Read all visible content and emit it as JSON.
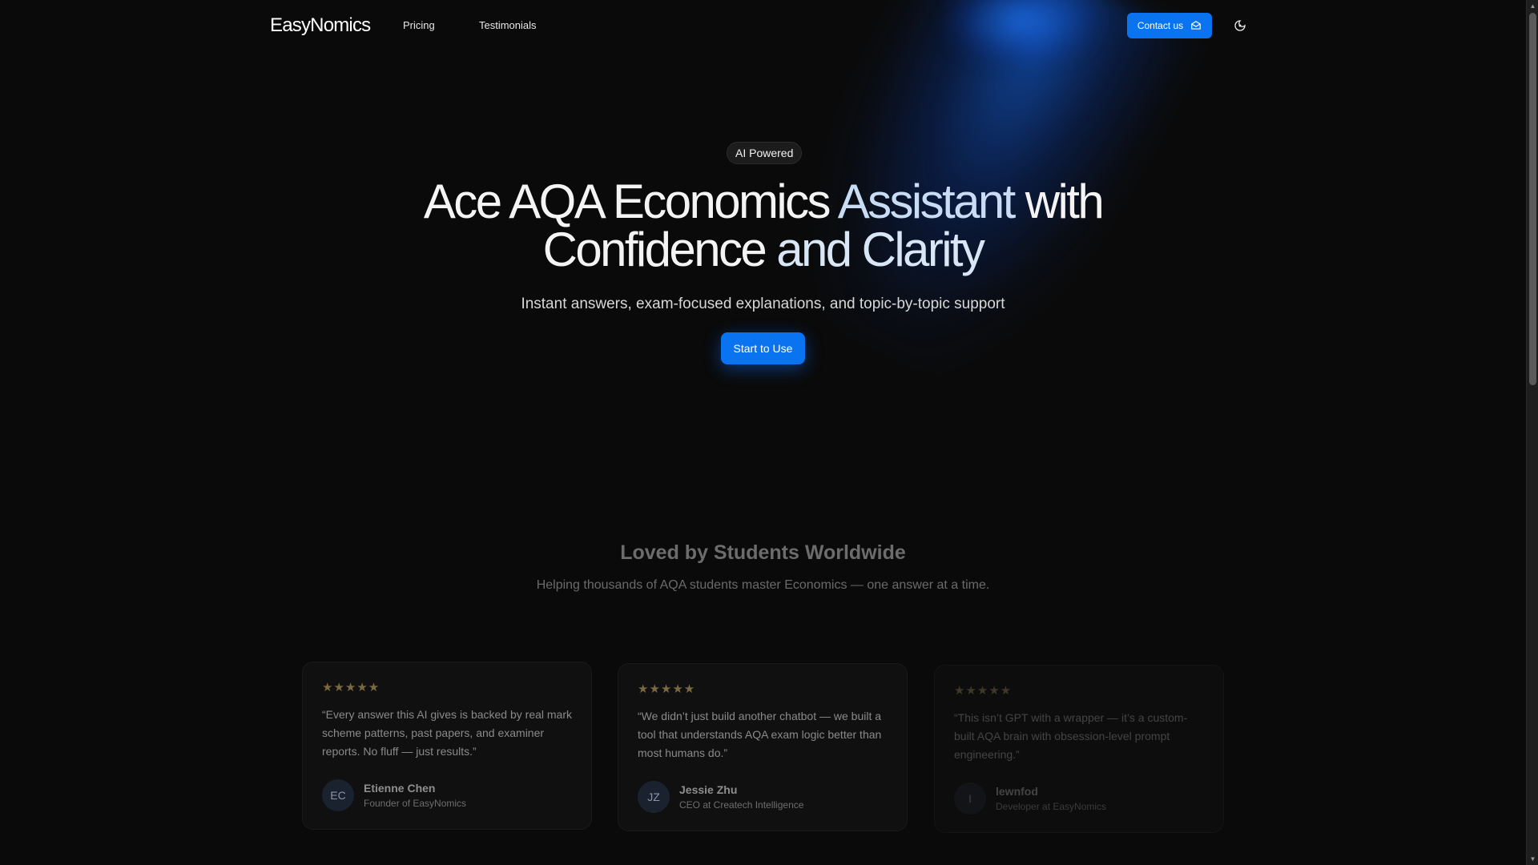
{
  "brand": {
    "logo": "EasyNomics",
    "accent_color": "#0a74f0"
  },
  "nav": {
    "links": [
      "Pricing",
      "Testimonials"
    ],
    "contact_label": "Contact us",
    "contact_icon": "mail-icon",
    "theme_icon": "theme-toggle-icon"
  },
  "hero": {
    "badge": "AI Powered",
    "title_part1": "Ace AQA Economics ",
    "title_highlight1": "Assistant",
    "title_part2": " with",
    "title_part3": "Confidence ",
    "title_highlight2": "and Clarity",
    "subtitle": "Instant answers, exam-focused explanations, and topic-by-topic support",
    "cta_label": "Start to Use"
  },
  "testimonials": {
    "title": "Loved by Students Worldwide",
    "subtitle": "Helping thousands of AQA students master Economics — one answer at a time.",
    "star_color": "#7a6a40",
    "items": [
      {
        "stars": "★★★★★",
        "quote": "“Every answer this AI gives is backed by real mark scheme patterns, past papers, and examiner reports. No fluff — just results.”",
        "initials": "EC",
        "name": "Etienne Chen",
        "role": "Founder of EasyNomics"
      },
      {
        "stars": "★★★★★",
        "quote": "“We didn’t just build another chatbot — we built a tool that understands AQA exam logic better than most humans do.”",
        "initials": "JZ",
        "name": "Jessie Zhu",
        "role": "CEO at Createch Intelligence"
      },
      {
        "stars": "★★★★★",
        "quote": "“This isn’t GPT with a wrapper — it’s a custom-built AQA brain with obsession-level prompt engineering.”",
        "initials": "I",
        "name": "lewnfod",
        "role": "Developer at EasyNomics"
      }
    ]
  }
}
